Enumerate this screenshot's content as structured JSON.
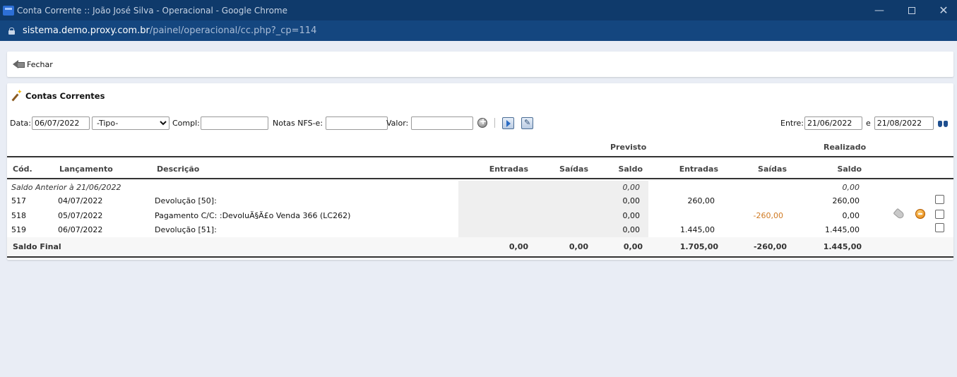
{
  "window": {
    "title": "Conta Corrente :: João José Silva - Operacional - Google Chrome",
    "url_host": "sistema.demo.proxy.com.br",
    "url_path": "/painel/operacional/cc.php?_cp=114",
    "min_glyph": "—",
    "close_glyph": "✕"
  },
  "toolbar": {
    "close_label": "Fechar"
  },
  "section": {
    "title": "Contas Correntes"
  },
  "filters": {
    "data_label": "Data:",
    "data_value": "06/07/2022",
    "tipo_selected": "-Tipo-",
    "compl_label": "Compl:",
    "compl_value": "",
    "notas_label": "Notas NFS-e:",
    "notas_value": "",
    "valor_label": "Valor:",
    "valor_value": "",
    "entre_label": "Entre:",
    "entre_from": "21/06/2022",
    "e_label": "e",
    "entre_to": "21/08/2022"
  },
  "table": {
    "group_previsto": "Previsto",
    "group_realizado": "Realizado",
    "headers": {
      "cod": "Cód.",
      "lancamento": "Lançamento",
      "descricao": "Descrição",
      "prev_entradas": "Entradas",
      "prev_saidas": "Saídas",
      "prev_saldo": "Saldo",
      "real_entradas": "Entradas",
      "real_saidas": "Saídas",
      "real_saldo": "Saldo"
    },
    "saldo_anterior": {
      "label": "Saldo Anterior à 21/06/2022",
      "prev_saldo": "0,00",
      "real_saldo": "0,00"
    },
    "rows": [
      {
        "cod": "517",
        "lancamento": "04/07/2022",
        "descricao": "Devolução [50]:",
        "prev_entradas": "",
        "prev_saidas": "",
        "prev_saldo": "0,00",
        "real_entradas": "260,00",
        "real_saidas": "",
        "real_saldo": "260,00"
      },
      {
        "cod": "518",
        "lancamento": "05/07/2022",
        "descricao": "Pagamento C/C: :DevoluÃ§Ã£o Venda 366 (LC262)",
        "prev_entradas": "",
        "prev_saidas": "",
        "prev_saldo": "0,00",
        "real_entradas": "",
        "real_saidas": "-260,00",
        "real_saldo": "0,00"
      },
      {
        "cod": "519",
        "lancamento": "06/07/2022",
        "descricao": "Devolução [51]:",
        "prev_entradas": "",
        "prev_saidas": "",
        "prev_saldo": "0,00",
        "real_entradas": "1.445,00",
        "real_saidas": "",
        "real_saldo": "1.445,00"
      }
    ],
    "saldo_final": {
      "label": "Saldo Final",
      "prev_entradas": "0,00",
      "prev_saidas": "0,00",
      "prev_saldo": "0,00",
      "real_entradas": "1.705,00",
      "real_saidas": "-260,00",
      "real_saldo": "1.445,00"
    }
  },
  "colors": {
    "titlebar": "#0f3a6b",
    "addressbar": "#14467f",
    "negative": "#d07a22",
    "background": "#e9edf5"
  }
}
